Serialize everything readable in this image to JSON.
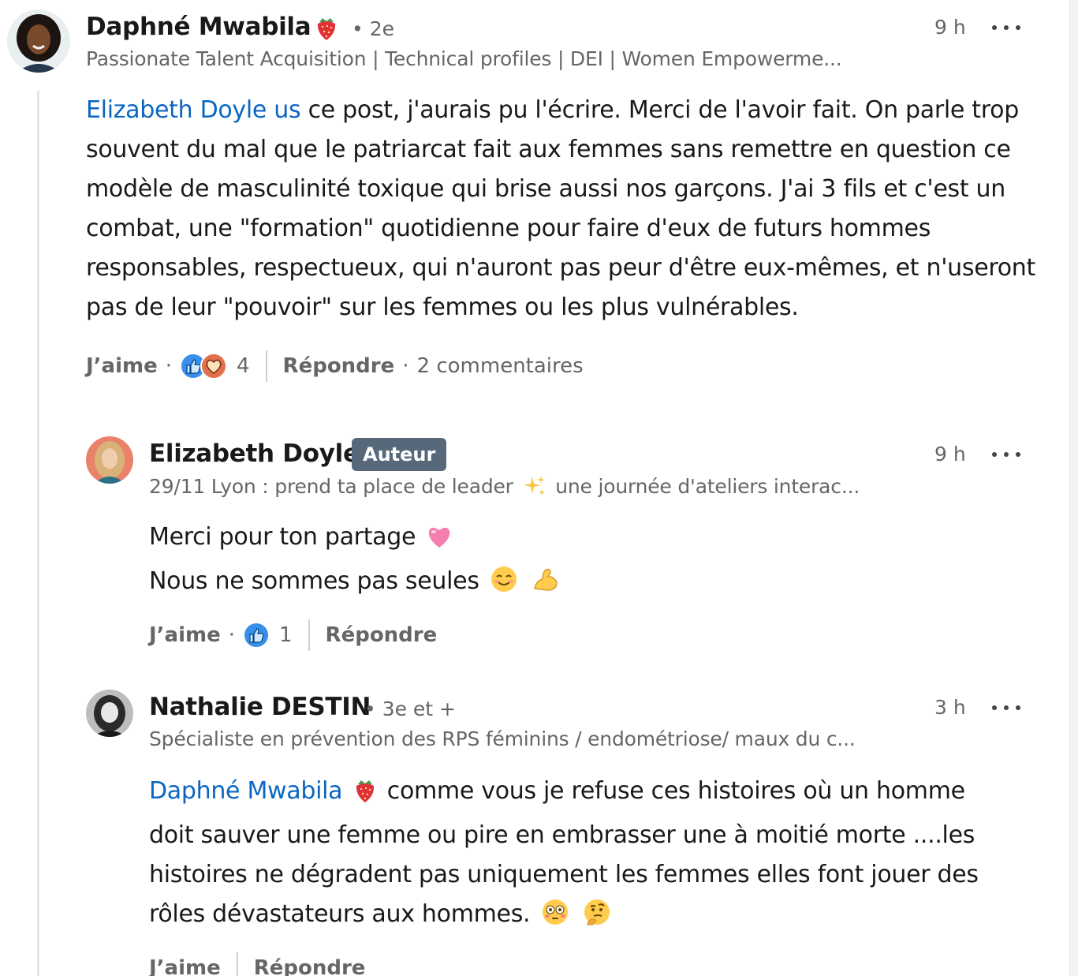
{
  "colors": {
    "mention": "#0a66c2",
    "meta": "#666666",
    "badge_bg": "#56687a",
    "like_blue": "#378fe9",
    "love_red": "#df704d"
  },
  "comment1": {
    "author": "Daphné Mwabila",
    "degree": "• 2e",
    "headline": "Passionate Talent Acquisition | Technical profiles | DEI | Women Empowerme...",
    "time": "9 h",
    "mention": "Elizabeth Doyle us",
    "text": " ce post, j'aurais pu l'écrire. Merci de l'avoir fait. On parle trop souvent du mal que le patriarcat fait aux femmes sans remettre en question ce modèle de masculinité toxique qui brise aussi nos garçons. J'ai 3 fils et c'est un combat, une \"formation\" quotidienne pour faire d'eux de futurs hommes responsables, respectueux, qui n'auront pas peur d'être eux-mêmes, et n'useront pas de leur \"pouvoir\" sur les femmes ou les plus vulnérables.",
    "like_label": "J’aime",
    "reaction_count": "4",
    "reply_label": "Répondre",
    "comments_count": "2 commentaires"
  },
  "reply1": {
    "author": "Elizabeth Doyle",
    "badge": "Auteur",
    "headline_pre": "29/11 Lyon : prend ta place de leader",
    "headline_post": "une journée d'ateliers interac...",
    "time": "9 h",
    "line1": "Merci pour ton partage",
    "line2": "Nous ne sommes pas seules",
    "like_label": "J’aime",
    "reaction_count": "1",
    "reply_label": "Répondre"
  },
  "reply2": {
    "author": "Nathalie DESTIN",
    "degree": "• 3e et +",
    "headline": "Spécialiste en prévention des RPS féminins / endométriose/ maux du c...",
    "time": "3 h",
    "mention": "Daphné Mwabila",
    "line1_rest": "comme vous je refuse ces histoires où un homme",
    "line2": "doit sauver une femme ou pire en embrasser une à moitié morte ....les",
    "line3": "histoires ne dégradent pas uniquement les femmes elles font jouer des",
    "line4": "rôles dévastateurs aux hommes.",
    "like_label": "J’aime",
    "reply_label": "Répondre"
  }
}
